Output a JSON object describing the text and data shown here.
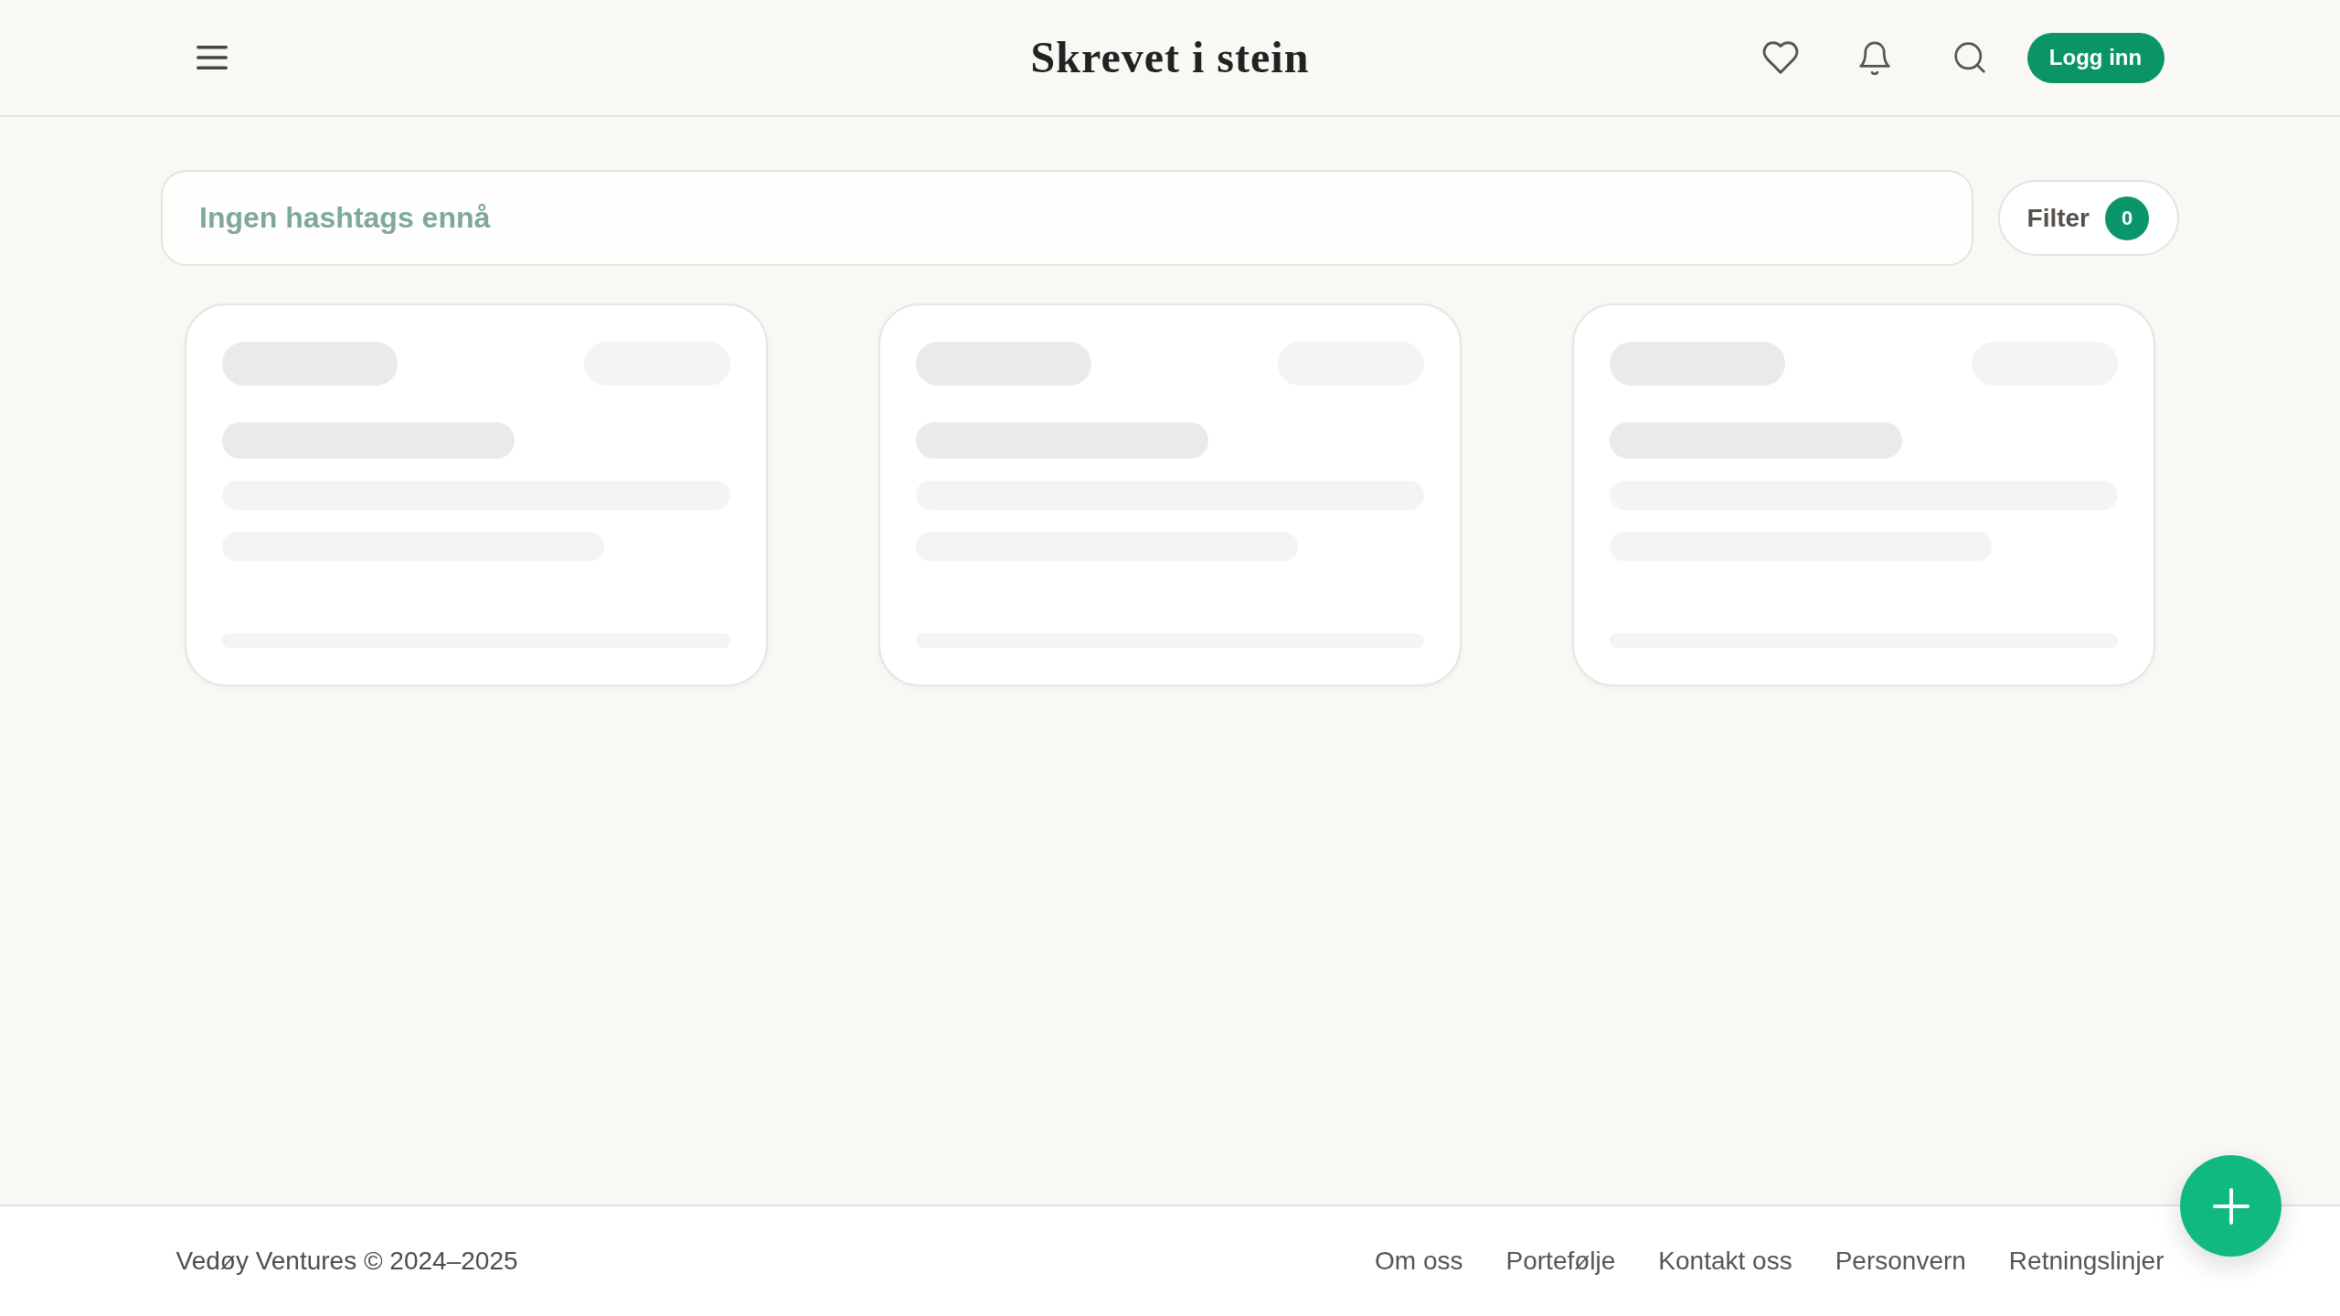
{
  "header": {
    "title": "Skrevet i stein",
    "login_button": "Logg inn"
  },
  "hashtag_field": {
    "placeholder": "Ingen hashtags ennå"
  },
  "filter": {
    "label": "Filter",
    "count": "0"
  },
  "cards": [
    {
      "kind": "skeleton"
    },
    {
      "kind": "skeleton"
    },
    {
      "kind": "skeleton"
    }
  ],
  "footer": {
    "copyright": "Vedøy Ventures © 2024–2025",
    "links": [
      "Om oss",
      "Portefølje",
      "Kontakt oss",
      "Personvern",
      "Retningslinjer"
    ]
  }
}
